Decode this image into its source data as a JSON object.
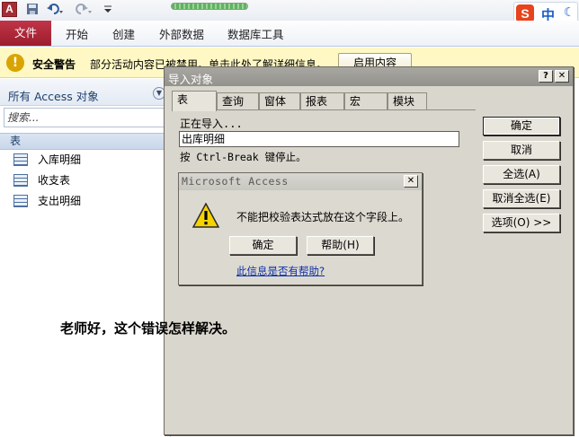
{
  "quick_access": {
    "app_icon_letter": "A",
    "save_icon": "save-icon",
    "undo_icon": "undo-icon",
    "redo_icon": "redo-icon",
    "customize_icon": "customize-qat-icon"
  },
  "ime": {
    "logo": "S",
    "mode": "中",
    "moon": "☾"
  },
  "ribbon": {
    "tabs": [
      "文件",
      "开始",
      "创建",
      "外部数据",
      "数据库工具"
    ]
  },
  "security_bar": {
    "title": "安全警告",
    "message": "部分活动内容已被禁用。单击此处了解详细信息。",
    "enable_button": "启用内容"
  },
  "nav_pane": {
    "header": "所有 Access 对象",
    "search_placeholder": "搜索...",
    "group": "表",
    "items": [
      "入库明细",
      "收支表",
      "支出明细"
    ]
  },
  "import_dialog": {
    "title": "导入对象",
    "help_glyph": "?",
    "close_glyph": "✕",
    "tabs": [
      "表",
      "查询",
      "窗体",
      "报表",
      "宏",
      "模块"
    ],
    "importing_label": "正在导入...",
    "current_table": "出库明细",
    "stop_hint": "按 Ctrl-Break 键停止。",
    "buttons": {
      "ok": "确定",
      "cancel": "取消",
      "select_all": "全选(A)",
      "deselect_all": "取消全选(E)",
      "options": "选项(O) >>"
    }
  },
  "error_dialog": {
    "title": "Microsoft Access",
    "close_glyph": "✕",
    "icon": "warning-icon",
    "message": "不能把校验表达式放在这个字段上。",
    "ok": "确定",
    "help": "帮助(H)",
    "help_link": "此信息是否有帮助?"
  },
  "caption": "老师好，这个错误怎样解决。"
}
